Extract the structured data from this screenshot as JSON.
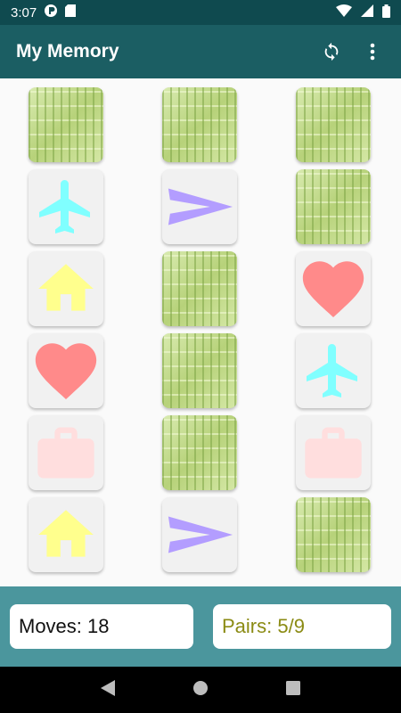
{
  "status_bar": {
    "time": "3:07"
  },
  "app_bar": {
    "title": "My Memory",
    "refresh_icon": "refresh-icon",
    "menu_icon": "more-vert-icon"
  },
  "board": {
    "columns": 3,
    "rows": 6,
    "cards": [
      {
        "state": "hidden"
      },
      {
        "state": "hidden"
      },
      {
        "state": "hidden"
      },
      {
        "state": "revealed",
        "icon": "airplane",
        "color": "#80ffff"
      },
      {
        "state": "revealed",
        "icon": "send",
        "color": "#b39dff"
      },
      {
        "state": "hidden"
      },
      {
        "state": "revealed",
        "icon": "home",
        "color": "#ffff8d"
      },
      {
        "state": "hidden"
      },
      {
        "state": "revealed",
        "icon": "heart",
        "color": "#ff8a8a"
      },
      {
        "state": "revealed",
        "icon": "heart",
        "color": "#ff8a8a"
      },
      {
        "state": "hidden"
      },
      {
        "state": "revealed",
        "icon": "airplane",
        "color": "#80ffff"
      },
      {
        "state": "revealed",
        "icon": "briefcase",
        "color": "#ffdede"
      },
      {
        "state": "hidden"
      },
      {
        "state": "revealed",
        "icon": "briefcase",
        "color": "#ffdede"
      },
      {
        "state": "revealed",
        "icon": "home",
        "color": "#ffff8d"
      },
      {
        "state": "revealed",
        "icon": "send",
        "color": "#b39dff"
      },
      {
        "state": "hidden"
      }
    ]
  },
  "stats": {
    "moves_label": "Moves: 18",
    "pairs_label": "Pairs: 5/9",
    "pairs_color": "#8b8b14"
  }
}
